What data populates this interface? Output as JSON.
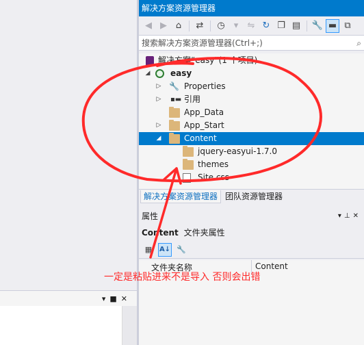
{
  "solution_explorer": {
    "title": "解决方案资源管理器",
    "search_placeholder": "搜索解决方案资源管理器(Ctrl+;)",
    "solution_label": "解决方案“easy”(1 个项目)",
    "project": "easy",
    "items": {
      "properties": "Properties",
      "references": "引用",
      "app_data": "App_Data",
      "app_start": "App_Start",
      "content": "Content",
      "jquery_easyui": "jquery-easyui-1.7.0",
      "themes": "themes",
      "site_css": "Site.css"
    },
    "tabs": {
      "active": "解决方案资源管理器",
      "other": "团队资源管理器"
    }
  },
  "properties": {
    "title": "属性",
    "object_name": "Content",
    "object_type": "文件夹属性",
    "row": {
      "name": "文件夹名称",
      "value": "Content"
    }
  },
  "annotation": {
    "text": "一定是粘贴进来不是导入 否则会出错",
    "color": "#ff2a2a"
  },
  "colors": {
    "accent": "#007acc",
    "folder": "#dcb67a",
    "selection": "#007acc"
  },
  "icons": {
    "toolbar": [
      "back-icon",
      "forward-icon",
      "home-icon",
      "sync-icon",
      "history-icon",
      "refresh-icon",
      "collapse-all-icon",
      "show-all-files-icon",
      "properties-wrench-icon",
      "pin-icon",
      "preview-icon"
    ]
  }
}
